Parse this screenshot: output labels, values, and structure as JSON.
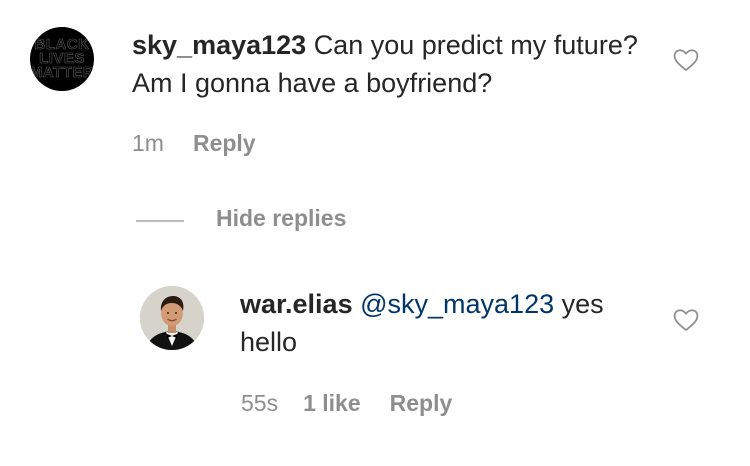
{
  "comment": {
    "avatar_text": [
      "BLACK",
      "LIVES",
      "MATTER"
    ],
    "username": "sky_maya123",
    "text": "Can you predict my future? Am I gonna have a boyfriend?",
    "time": "1m",
    "reply_label": "Reply"
  },
  "thread": {
    "hide_replies_label": "Hide replies"
  },
  "reply": {
    "username": "war.elias",
    "mention": "@sky_maya123",
    "text": "yes hello",
    "time": "55s",
    "likes": "1 like",
    "reply_label": "Reply"
  },
  "colors": {
    "text": "#262626",
    "secondary": "#8e8e8e",
    "mention": "#003569"
  },
  "icons": {
    "like": "heart-outline-icon"
  }
}
